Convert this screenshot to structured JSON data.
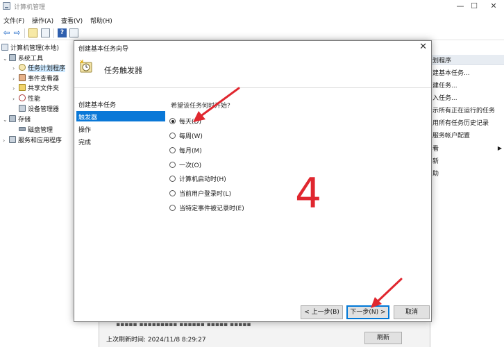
{
  "window": {
    "title": "计算机管理",
    "controls": [
      "—",
      "☐",
      "✕"
    ]
  },
  "menu": [
    "文件(F)",
    "操作(A)",
    "查看(V)",
    "帮助(H)"
  ],
  "tree": {
    "root": "计算机管理(本地)",
    "items": [
      {
        "label": "系统工具",
        "level": 1
      },
      {
        "label": "任务计划程序",
        "level": 2,
        "selected": true
      },
      {
        "label": "事件查看器",
        "level": 2
      },
      {
        "label": "共享文件夹",
        "level": 2
      },
      {
        "label": "性能",
        "level": 2
      },
      {
        "label": "设备管理器",
        "level": 2
      },
      {
        "label": "存储",
        "level": 1
      },
      {
        "label": "磁盘管理",
        "level": 2
      },
      {
        "label": "服务和应用程序",
        "level": 1
      }
    ]
  },
  "actions": {
    "header": "划程序",
    "items": [
      "建基本任务...",
      "建任务...",
      "入任务...",
      "示所有正在运行的任务",
      "用所有任务历史记录",
      "服务帐户配置",
      "看",
      "新",
      "助"
    ]
  },
  "bottom": {
    "refresh_time": "上次刷新时间: 2024/11/8 8:29:27",
    "refresh_button": "刷新"
  },
  "wizard": {
    "title": "创建基本任务向导",
    "close": "✕",
    "header": "任务触发器",
    "steps": [
      "创建基本任务",
      "触发器",
      "操作",
      "完成"
    ],
    "active_step": 1,
    "question": "希望该任务何时开始?",
    "options": [
      "每天(D)",
      "每周(W)",
      "每月(M)",
      "一次(O)",
      "计算机启动时(H)",
      "当前用户登录时(L)",
      "当特定事件被记录时(E)"
    ],
    "selected_option": 0,
    "buttons": {
      "back": "< 上一步(B)",
      "next": "下一步(N) >",
      "cancel": "取消"
    }
  },
  "annotation": "4",
  "colors": {
    "selection": "#0a78d7",
    "tree_selection": "#cce8ff",
    "annotation_red": "#e0272f",
    "actions_header": "#e7ecf2"
  }
}
